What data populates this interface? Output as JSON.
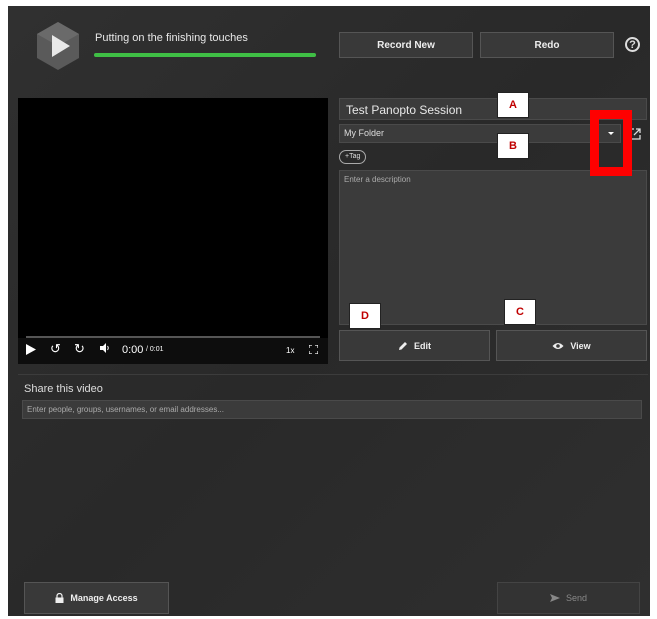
{
  "header": {
    "status_text": "Putting on the finishing touches",
    "progress_percent": 100,
    "record_new_label": "Record New",
    "redo_label": "Redo",
    "help_icon": "question-circle-icon"
  },
  "player": {
    "time_current": "0:00",
    "time_total": "/ 0:01",
    "speed_label": "1x",
    "icons": [
      "play-icon",
      "rewind-icon",
      "fast-forward-icon",
      "volume-icon",
      "fullscreen-icon"
    ]
  },
  "details": {
    "session_title": "Test Panopto Session",
    "folder": "My Folder",
    "tag_label": "+Tag",
    "description_placeholder": "Enter a description",
    "edit_label": "Edit",
    "view_label": "View"
  },
  "callouts": {
    "a": "A",
    "b": "B",
    "c": "C",
    "d": "D"
  },
  "share": {
    "title": "Share this video",
    "input_placeholder": "Enter people, groups, usernames, or email addresses...",
    "manage_access_label": "Manage Access",
    "send_label": "Send"
  },
  "colors": {
    "background": "#2b2b2b",
    "progress": "#3fbf45",
    "highlight": "#ff0000",
    "callout_text": "#c00000"
  }
}
